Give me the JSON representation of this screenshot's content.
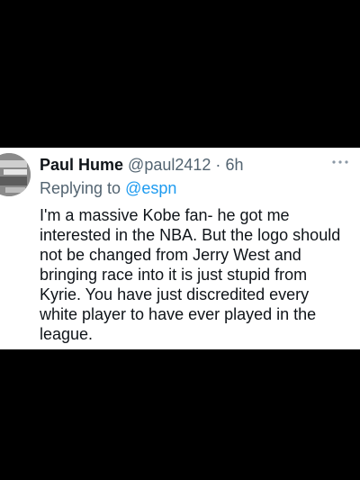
{
  "tweet": {
    "display_name": "Paul Hume",
    "handle": "@paul2412",
    "separator": "·",
    "time": "6h",
    "replying_prefix": "Replying to",
    "replying_handle": "@espn",
    "body_lines": [
      "I'm a massive Kobe fan- he got me",
      "interested in the NBA. But the logo should",
      "not be changed from Jerry West and",
      "bringing race into it is just stupid from",
      "Kyrie. You have just discredited every",
      "white player to have ever played in the",
      "league."
    ],
    "more_icon": "more-horizontal-icon"
  },
  "colors": {
    "background": "#000000",
    "card": "#ffffff",
    "text_primary": "#0f1419",
    "text_secondary": "#536471",
    "link": "#1d9bf0"
  }
}
